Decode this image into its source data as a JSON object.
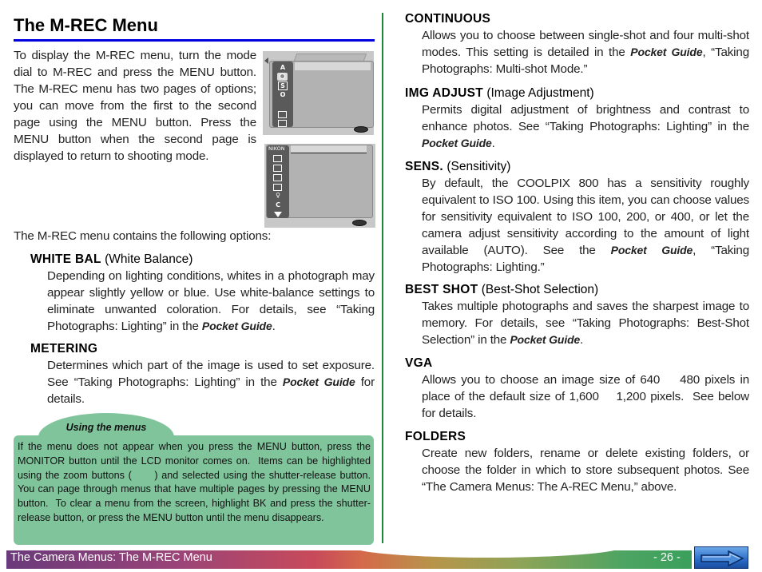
{
  "page": {
    "title": "The M-REC Menu",
    "accent_color": "#0000e0",
    "divider_color": "#1a8a3a"
  },
  "intro": {
    "text": "To display the M-REC menu, turn the mode dial to M-REC and press the MENU button. The M-REC menu has two pages of options; you can move from the first to the second page using the MENU button.  Press the MENU button when the second page is displayed to return to shooting mode."
  },
  "lcd_screens": [
    {
      "name": "menu-page-1",
      "side_glyphs": [
        "A",
        "◎",
        "S",
        "O",
        "□",
        "□"
      ]
    },
    {
      "name": "menu-page-2",
      "brand": "NIKON",
      "side_glyphs": [
        "□",
        "□",
        "□",
        "□",
        "♀",
        "C",
        "▼"
      ]
    }
  ],
  "options_intro": "The M-REC menu contains the following options:",
  "options": [
    {
      "id": "white-bal",
      "name": "WHITE BAL",
      "subtitle": "(White Balance)",
      "desc_before": "Depending on lighting conditions, whites in a photograph may appear slightly yellow or blue.  Use white-balance settings to eliminate unwanted coloration.  For details, see “Taking Photographs: Lighting” in the ",
      "desc_em": "Pocket Guide",
      "desc_after": "."
    },
    {
      "id": "metering",
      "name": "METERING",
      "subtitle": "",
      "desc_before": "Determines which part of the image is used to set exposure. See “Taking Photographs: Lighting” in the ",
      "desc_em": "Pocket Guide",
      "desc_after": " for details."
    },
    {
      "id": "continuous",
      "name": "CONTINUOUS",
      "subtitle": "",
      "desc_before": "Allows you to choose between single-shot and four multi-shot modes.  This setting is detailed in the ",
      "desc_em": "Pocket Guide",
      "desc_after": ", “Taking Photographs: Multi-shot Mode.”"
    },
    {
      "id": "img-adjust",
      "name": "IMG ADJUST",
      "subtitle": "(Image Adjustment)",
      "desc_before": "Permits digital adjustment of brightness and contrast to enhance photos.  See “Taking Photographs: Lighting” in the ",
      "desc_em": "Pocket Guide",
      "desc_after": "."
    },
    {
      "id": "sens",
      "name": "SENS.",
      "subtitle": "(Sensitivity)",
      "desc_before": "By default, the COOLPIX 800 has a sensitivity roughly equivalent to ISO 100.  Using this item, you can choose values for sensitivity equivalent to ISO 100, 200, or 400, or let the camera adjust sensitivity according to the amount of light available (AUTO).  See the ",
      "desc_em": "Pocket Guide",
      "desc_after": ", “Taking Photographs: Lighting.”"
    },
    {
      "id": "best-shot",
      "name": "BEST SHOT",
      "subtitle": "(Best-Shot Selection)",
      "desc_before": "Takes multiple photographs and saves the sharpest image to memory.  For details, see “Taking Photographs: Best-Shot Selection” in the ",
      "desc_em": "Pocket Guide",
      "desc_after": "."
    },
    {
      "id": "vga",
      "name": "VGA",
      "subtitle": "",
      "desc_before": "Allows you to choose an image size of 640    480 pixels in place of the default size of 1,600    1,200 pixels.  See below for details.",
      "desc_em": "",
      "desc_after": ""
    },
    {
      "id": "folders",
      "name": "FOLDERS",
      "subtitle": "",
      "desc_before": "Create new folders, rename or delete existing folders, or choose the folder in which to store subsequent photos.  See “The Camera Menus: The A-REC Menu,” above.",
      "desc_em": "",
      "desc_after": ""
    }
  ],
  "tip": {
    "heading": "Using the menus",
    "text": "If the menu does not appear when you press the MENU button, press the MONITOR button until the LCD monitor comes on.  Items can be highlighted using the zoom buttons (      ) and selected using the shutter-release button.  You can page through menus that have multiple pages by pressing the MENU button.  To clear a menu from the screen, highlight BK and press the shutter-release button, or press the MENU button until the menu disappears.",
    "background_color": "#80c49c"
  },
  "footer": {
    "section_title": "The Camera Menus: The M-REC Menu",
    "page_number": "- 26 -",
    "next_icon": "right-arrow-icon"
  }
}
